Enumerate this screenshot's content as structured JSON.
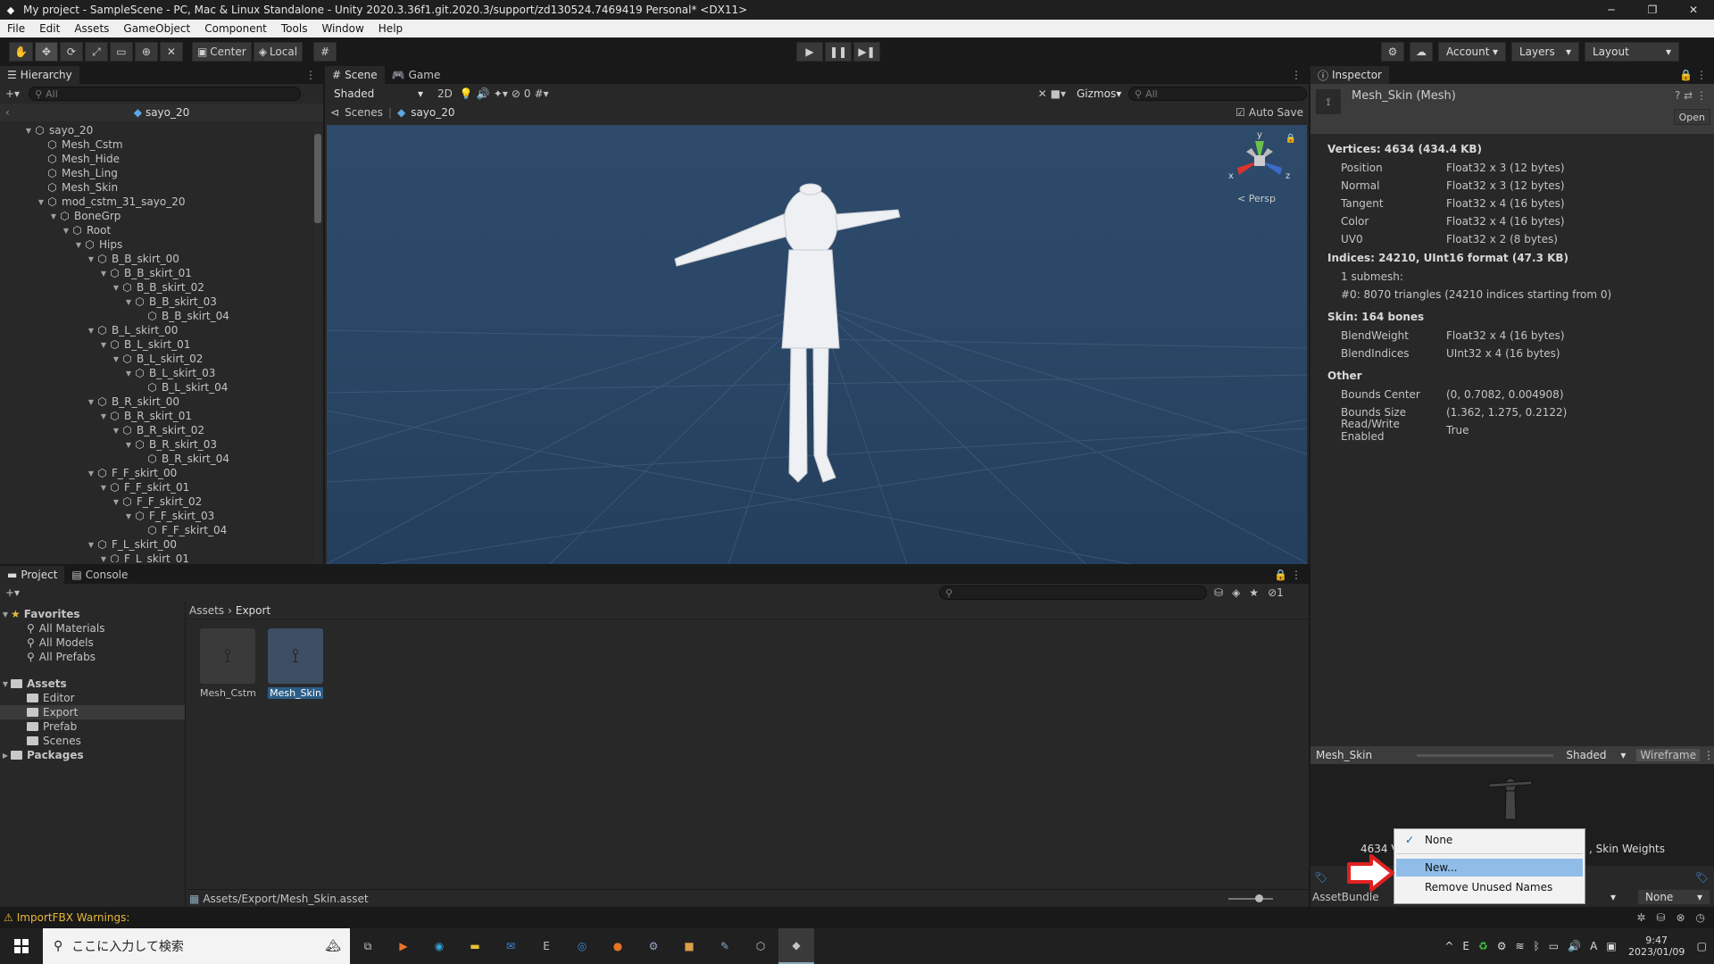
{
  "window": {
    "title": "My project - SampleScene - PC, Mac & Linux Standalone - Unity 2020.3.36f1.git.2020.3/support/zd130524.7469419 Personal* <DX11>"
  },
  "menu": [
    "File",
    "Edit",
    "Assets",
    "GameObject",
    "Component",
    "Tools",
    "Window",
    "Help"
  ],
  "toolbar": {
    "center": "Center",
    "local": "Local",
    "account": "Account",
    "layers": "Layers",
    "layout": "Layout"
  },
  "hierarchy": {
    "tab": "Hierarchy",
    "search_placeholder": "All",
    "scene_name": "sayo_20",
    "rows": [
      {
        "label": "sayo_20",
        "depth": 0,
        "arrow": "▼"
      },
      {
        "label": "Mesh_Cstm",
        "depth": 1,
        "arrow": ""
      },
      {
        "label": "Mesh_Hide",
        "depth": 1,
        "arrow": ""
      },
      {
        "label": "Mesh_Ling",
        "depth": 1,
        "arrow": ""
      },
      {
        "label": "Mesh_Skin",
        "depth": 1,
        "arrow": ""
      },
      {
        "label": "mod_cstm_31_sayo_20",
        "depth": 1,
        "arrow": "▼"
      },
      {
        "label": "BoneGrp",
        "depth": 2,
        "arrow": "▼"
      },
      {
        "label": "Root",
        "depth": 3,
        "arrow": "▼"
      },
      {
        "label": "Hips",
        "depth": 4,
        "arrow": "▼"
      },
      {
        "label": "B_B_skirt_00",
        "depth": 5,
        "arrow": "▼"
      },
      {
        "label": "B_B_skirt_01",
        "depth": 6,
        "arrow": "▼"
      },
      {
        "label": "B_B_skirt_02",
        "depth": 7,
        "arrow": "▼"
      },
      {
        "label": "B_B_skirt_03",
        "depth": 8,
        "arrow": "▼"
      },
      {
        "label": "B_B_skirt_04",
        "depth": 9,
        "arrow": ""
      },
      {
        "label": "B_L_skirt_00",
        "depth": 5,
        "arrow": "▼"
      },
      {
        "label": "B_L_skirt_01",
        "depth": 6,
        "arrow": "▼"
      },
      {
        "label": "B_L_skirt_02",
        "depth": 7,
        "arrow": "▼"
      },
      {
        "label": "B_L_skirt_03",
        "depth": 8,
        "arrow": "▼"
      },
      {
        "label": "B_L_skirt_04",
        "depth": 9,
        "arrow": ""
      },
      {
        "label": "B_R_skirt_00",
        "depth": 5,
        "arrow": "▼"
      },
      {
        "label": "B_R_skirt_01",
        "depth": 6,
        "arrow": "▼"
      },
      {
        "label": "B_R_skirt_02",
        "depth": 7,
        "arrow": "▼"
      },
      {
        "label": "B_R_skirt_03",
        "depth": 8,
        "arrow": "▼"
      },
      {
        "label": "B_R_skirt_04",
        "depth": 9,
        "arrow": ""
      },
      {
        "label": "F_F_skirt_00",
        "depth": 5,
        "arrow": "▼"
      },
      {
        "label": "F_F_skirt_01",
        "depth": 6,
        "arrow": "▼"
      },
      {
        "label": "F_F_skirt_02",
        "depth": 7,
        "arrow": "▼"
      },
      {
        "label": "F_F_skirt_03",
        "depth": 8,
        "arrow": "▼"
      },
      {
        "label": "F_F_skirt_04",
        "depth": 9,
        "arrow": ""
      },
      {
        "label": "F_L_skirt_00",
        "depth": 5,
        "arrow": "▼"
      },
      {
        "label": "F_L_skirt_01",
        "depth": 6,
        "arrow": "▼"
      }
    ]
  },
  "scene": {
    "tab_scene": "Scene",
    "tab_game": "Game",
    "shading": "Shaded",
    "mode2d": "2D",
    "hidden_count": "0",
    "gizmos": "Gizmos",
    "search_placeholder": "All",
    "breadcrumb_root": "Scenes",
    "breadcrumb_item": "sayo_20",
    "autosave": "Auto Save",
    "persp": "< Persp",
    "axis_y": "y",
    "axis_x": "x",
    "axis_z": "z"
  },
  "inspector": {
    "tab": "Inspector",
    "title": "Mesh_Skin (Mesh)",
    "open": "Open",
    "vertices_header": "Vertices: 4634 (434.4 KB)",
    "vertices": [
      [
        "Position",
        "Float32 x 3 (12 bytes)"
      ],
      [
        "Normal",
        "Float32 x 3 (12 bytes)"
      ],
      [
        "Tangent",
        "Float32 x 4 (16 bytes)"
      ],
      [
        "Color",
        "Float32 x 4 (16 bytes)"
      ],
      [
        "UV0",
        "Float32 x 2 (8 bytes)"
      ]
    ],
    "indices_header": "Indices: 24210, UInt16 format (47.3 KB)",
    "submesh_count": "1 submesh:",
    "submesh_detail": "#0: 8070 triangles (24210 indices starting from 0)",
    "skin_header": "Skin: 164 bones",
    "skin": [
      [
        "BlendWeight",
        "Float32 x 4 (16 bytes)"
      ],
      [
        "BlendIndices",
        "UInt32 x 4 (16 bytes)"
      ]
    ],
    "other_header": "Other",
    "other": [
      [
        "Bounds Center",
        "(0, 0.7082, 0.004908)"
      ],
      [
        "Bounds Size",
        "(1.362, 1.275, 0.2122)"
      ],
      [
        "Read/Write Enabled",
        "True"
      ]
    ],
    "preview_name": "Mesh_Skin",
    "preview_shading": "Shaded",
    "wireframe": "Wireframe",
    "preview_info_left": "4634 V",
    "preview_info_right": ", Skin Weights",
    "assetbundle": "AssetBundle",
    "assetbundle_variant": "None"
  },
  "dropdown": {
    "items": [
      "None",
      "New...",
      "Remove Unused Names"
    ]
  },
  "project": {
    "tab_project": "Project",
    "tab_console": "Console",
    "breadcrumb_root": "Assets",
    "breadcrumb_item": "Export",
    "hidden_count": "1",
    "favorites": "Favorites",
    "fav_items": [
      "All Materials",
      "All Models",
      "All Prefabs"
    ],
    "assets": "Assets",
    "asset_folders": [
      "Editor",
      "Export",
      "Prefab",
      "Scenes"
    ],
    "packages": "Packages",
    "files": [
      "Mesh_Cstm",
      "Mesh_Skin"
    ],
    "path": "Assets/Export/Mesh_Skin.asset"
  },
  "status": {
    "warning": "ImportFBX Warnings:"
  },
  "taskbar": {
    "search_placeholder": "ここに入力して検索",
    "time": "9:47",
    "date": "2023/01/09",
    "ime": "A"
  }
}
